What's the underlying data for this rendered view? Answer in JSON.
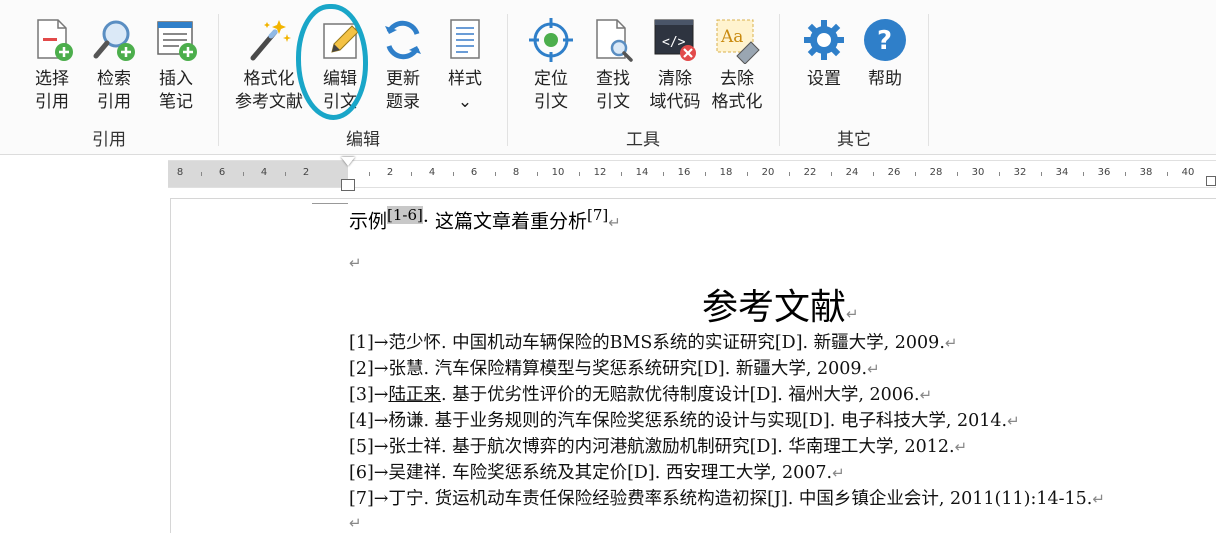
{
  "ribbon": {
    "groups": [
      {
        "label": "引用",
        "buttons": [
          {
            "id": "select",
            "label": "选择\n引用"
          },
          {
            "id": "search",
            "label": "检索\n引用"
          },
          {
            "id": "note",
            "label": "插入\n笔记"
          }
        ]
      },
      {
        "label": "编辑",
        "buttons": [
          {
            "id": "format",
            "label": "格式化\n参考文献"
          },
          {
            "id": "edit",
            "label": "编辑\n引文"
          },
          {
            "id": "update",
            "label": "更新\n题录"
          },
          {
            "id": "style",
            "label": "样式\n⌄"
          }
        ]
      },
      {
        "label": "工具",
        "buttons": [
          {
            "id": "locate",
            "label": "定位\n引文"
          },
          {
            "id": "find",
            "label": "查找\n引文"
          },
          {
            "id": "clear",
            "label": "清除\n域代码"
          },
          {
            "id": "unformat",
            "label": "去除\n格式化"
          }
        ]
      },
      {
        "label": "其它",
        "buttons": [
          {
            "id": "settings",
            "label": "设置"
          },
          {
            "id": "help",
            "label": "帮助"
          }
        ]
      }
    ]
  },
  "ruler": {
    "left_ticks": [
      "8",
      "6",
      "4",
      "2"
    ],
    "right_ticks": [
      "2",
      "4",
      "6",
      "8",
      "10",
      "12",
      "14",
      "16",
      "18",
      "20",
      "22",
      "24",
      "26",
      "28",
      "30",
      "32",
      "34",
      "36",
      "38",
      "40"
    ]
  },
  "document": {
    "line1_prefix": "示例",
    "line1_cite": "[1-6]",
    "line1_middle": "· 这篇文章着重分析",
    "line1_cite2": "[7]",
    "paragraph_mark": "↵",
    "heading": "参考文献",
    "references": [
      {
        "num": "[1]→",
        "author": "范少怀",
        "rest": ". 中国机动车辆保险的BMS系统的实证研究[D]. 新疆大学, 2009."
      },
      {
        "num": "[2]→",
        "author": "张慧",
        "rest": ". 汽车保险精算模型与奖惩系统研究[D]. 新疆大学, 2009."
      },
      {
        "num": "[3]→",
        "author": "陆正来",
        "rest": ". 基于优劣性评价的无赔款优待制度设计[D]. 福州大学, 2006."
      },
      {
        "num": "[4]→",
        "author": "杨谦",
        "rest": ". 基于业务规则的汽车保险奖惩系统的设计与实现[D]. 电子科技大学, 2014."
      },
      {
        "num": "[5]→",
        "author": "张士祥",
        "rest": ". 基于航次博弈的内河港航激励机制研究[D]. 华南理工大学, 2012."
      },
      {
        "num": "[6]→",
        "author": "吴建祥",
        "rest": ". 车险奖惩系统及其定价[D]. 西安理工大学, 2007."
      },
      {
        "num": "[7]→",
        "author": "丁宁",
        "rest": ". 货运机动车责任保险经验费率系统构造初探[J]. 中国乡镇企业会计, 2011(11):14-15."
      }
    ]
  },
  "colors": {
    "accent": "#19a6c8",
    "icon_blue": "#2f7fc9",
    "icon_green": "#4cae4c",
    "icon_red": "#e24a4a"
  }
}
